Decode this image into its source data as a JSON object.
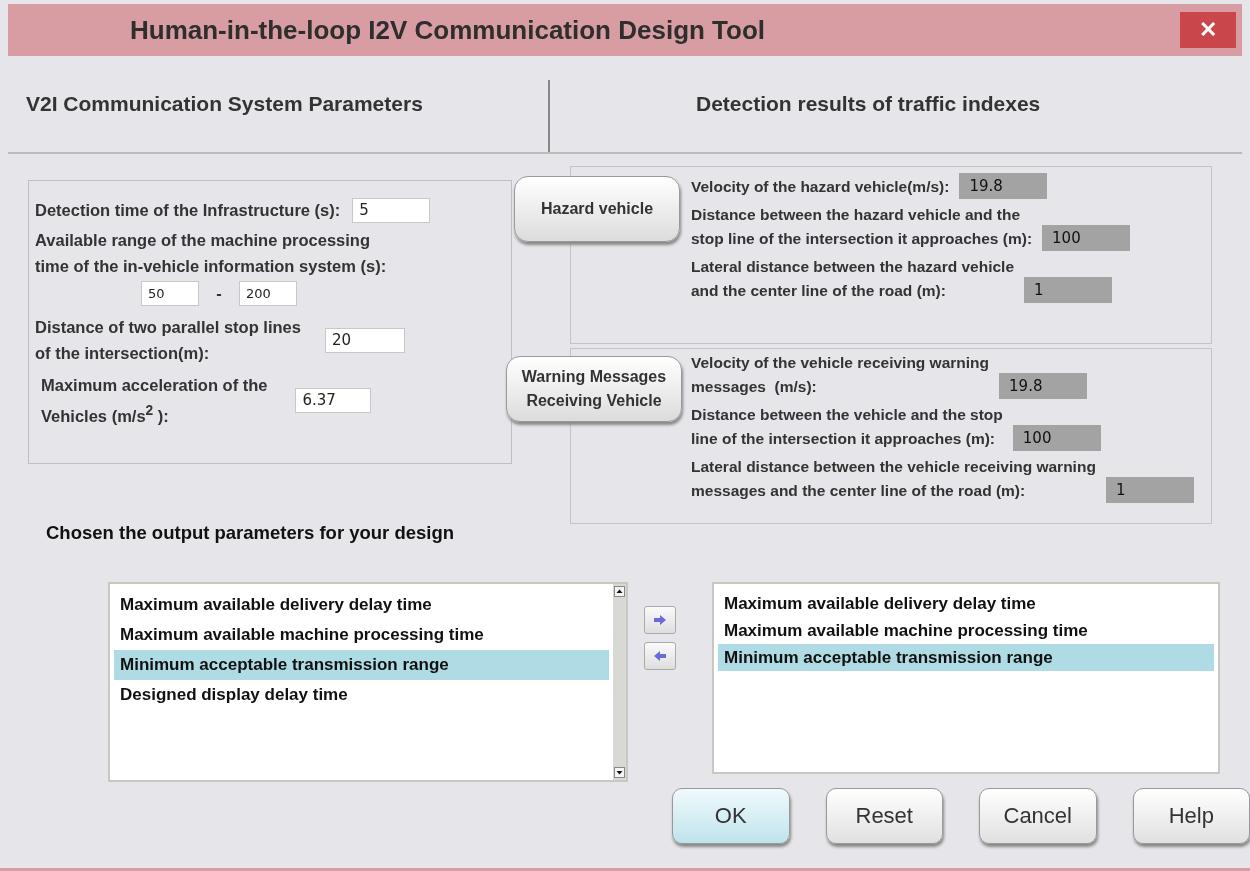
{
  "window": {
    "title": "Human-in-the-loop I2V Communication Design Tool",
    "close": "✕"
  },
  "headers": [
    "V2I Communication System Parameters",
    "Detection results of traffic indexes"
  ],
  "system_parameters": [
    {
      "kind": "single",
      "label": "Detection time of the Infrastructure (s):",
      "values": [
        "5"
      ]
    },
    {
      "kind": "range",
      "label": "Available range of the machine processing\ntime of the in-vehicle information system (s):",
      "values": [
        "50",
        "200"
      ],
      "separator": "-"
    },
    {
      "kind": "single",
      "label": "Distance of two parallel stop lines\nof the intersection(m):",
      "values": [
        "20"
      ]
    },
    {
      "kind": "single",
      "label": "Maximum acceleration of the\n Vehicles (m/s$^{2}$  ):",
      "values": [
        "6.37"
      ]
    }
  ],
  "groups": [
    {
      "button": "Hazard vehicle",
      "fields": [
        {
          "label": "Velocity of the hazard vehicle(m/s):",
          "value": "19.8"
        },
        {
          "label": "Distance between the hazard vehicle and the\nstop line of the intersection it approaches (m):",
          "value": "100"
        },
        {
          "label": "Lateral distance between the hazard vehicle\nand the center line of the road (m):",
          "value": "1"
        }
      ]
    },
    {
      "button": "Warning Messages\nReceiving Vehicle",
      "fields": [
        {
          "label": "Velocity of the vehicle receiving warning\nmessages  (m/s):",
          "value": "19.8"
        },
        {
          "label": "Distance between the vehicle and the stop\nline of the intersection it approaches (m):",
          "value": "100"
        },
        {
          "label": "Lateral distance between the vehicle receiving warning\nmessages and the center line of the road (m):",
          "value": "1"
        }
      ]
    }
  ],
  "output": {
    "heading": "Chosen the output parameters for your design",
    "available": [
      {
        "label": "Maximum available delivery delay time",
        "selected": false
      },
      {
        "label": "Maximum available machine processing time",
        "selected": false
      },
      {
        "label": "Minimum acceptable transmission range",
        "selected": true
      },
      {
        "label": "Designed display delay time",
        "selected": false
      }
    ],
    "chosen": [
      {
        "label": "Maximum available delivery delay time",
        "selected": false
      },
      {
        "label": "Maximum available machine processing time",
        "selected": false
      },
      {
        "label": "Minimum acceptable transmission range",
        "selected": true
      }
    ]
  },
  "buttons": [
    {
      "label": "OK",
      "default": true
    },
    {
      "label": "Reset",
      "default": false
    },
    {
      "label": "Cancel",
      "default": false
    },
    {
      "label": "Help",
      "default": false
    }
  ]
}
